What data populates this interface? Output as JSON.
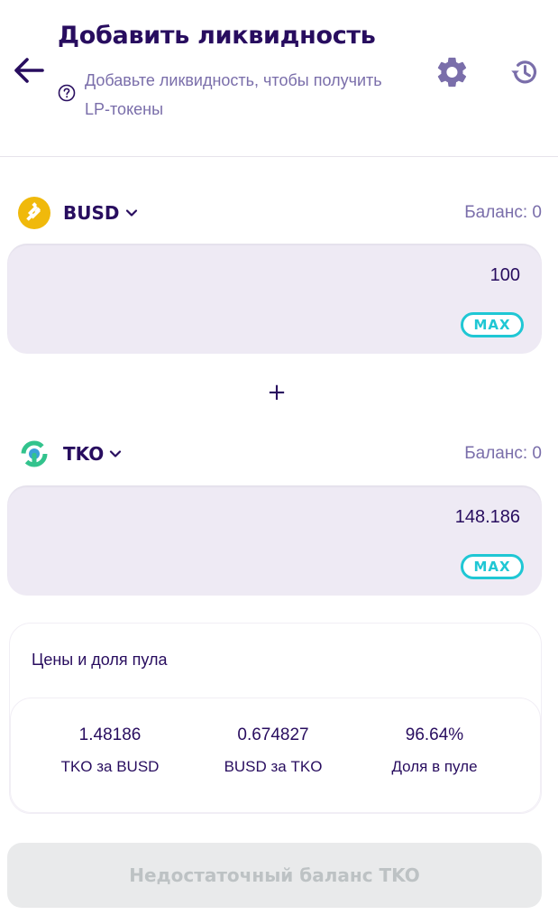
{
  "header": {
    "title": "Добавить ликвидность",
    "subtitle": "Добавьте ликвидность, чтобы получить LP-токены"
  },
  "token_a": {
    "symbol": "BUSD",
    "balance_label": "Баланс: 0",
    "amount": "100",
    "max_label": "MAX",
    "logo_color": "#f0b90b"
  },
  "plus_sign": "+",
  "token_b": {
    "symbol": "TKO",
    "balance_label": "Баланс: 0",
    "amount": "148.186",
    "max_label": "MAX",
    "logo_color": "#32c38d"
  },
  "pool": {
    "title": "Цены и доля пула",
    "stats": [
      {
        "value": "1.48186",
        "label": "TKO за BUSD"
      },
      {
        "value": "0.674827",
        "label": "BUSD за TKO"
      },
      {
        "value": "96.64%",
        "label": "Доля в пуле"
      }
    ]
  },
  "submit_label": "Недостаточный баланс TKO",
  "colors": {
    "primary_text": "#280d5f",
    "secondary_text": "#7a6eaa",
    "accent": "#1fc7d4",
    "input_bg": "#eeeaf4",
    "disabled_bg": "#e9eaeb",
    "disabled_text": "#bdc2c4"
  }
}
